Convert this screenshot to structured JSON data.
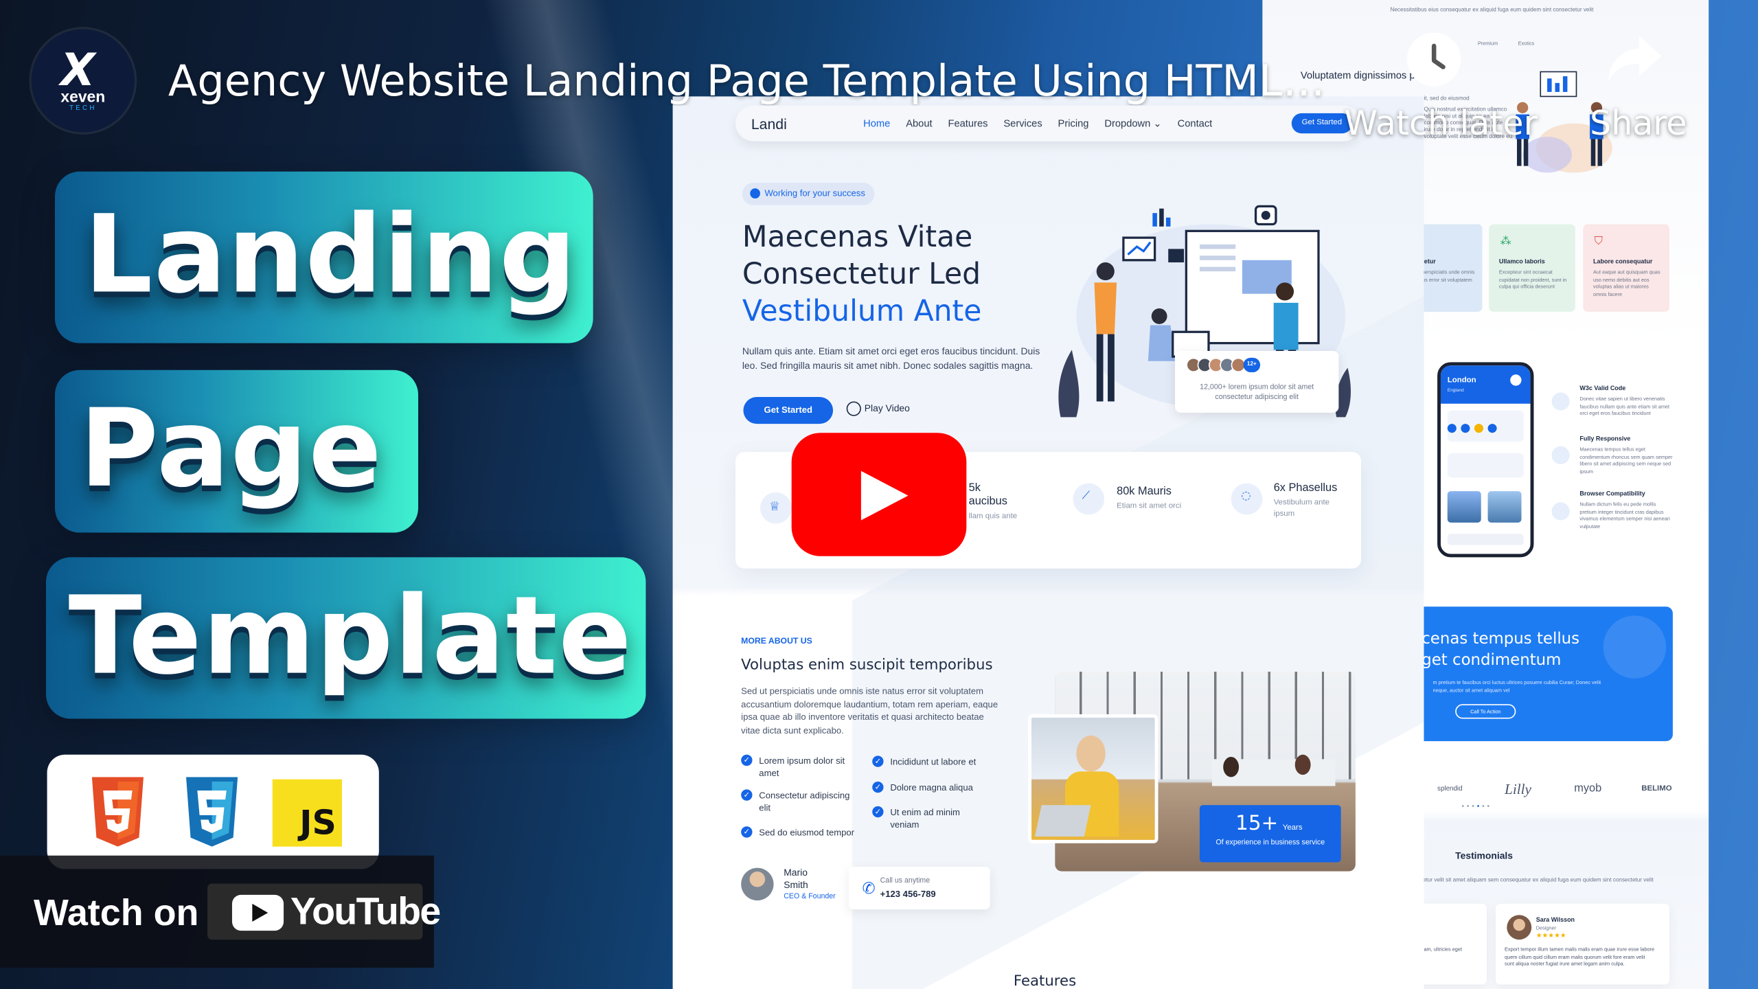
{
  "video": {
    "title": "Agency Website Landing Page Template Using HTML C...",
    "watch_later": "Watch later",
    "share": "Share",
    "watch_on": "Watch on",
    "youtube": "YouTube"
  },
  "channel": {
    "name": "xeven",
    "tag": "TECH"
  },
  "thumbnail": {
    "line1": "Landing",
    "line2": "Page",
    "line3": "Template",
    "badges": [
      "html5-icon",
      "css3-icon",
      "js-icon"
    ],
    "js_label": "JS"
  },
  "mockup": {
    "brand": "Landi",
    "nav": [
      "Home",
      "About",
      "Features",
      "Services",
      "Pricing",
      "Dropdown",
      "Contact"
    ],
    "nav_cta": "Get Started",
    "chip": "Working for your success",
    "heading_l1": "Maecenas Vitae",
    "heading_l2": "Consectetur Led",
    "heading_l3": "Vestibulum Ante",
    "paragraph": "Nullam quis ante. Etiam sit amet orci eget eros faucibus tincidunt. Duis leo. Sed fringilla mauris sit amet nibh. Donec sodales sagittis magna.",
    "btn_primary": "Get Started",
    "btn_play": "Play Video",
    "card_note": "12,000+ lorem ipsum dolor sit amet consectetur adipiscing elit",
    "card_count": "12+",
    "stats": [
      {
        "title": "5k",
        "title2": "aucibus",
        "sub": "llam quis ante"
      },
      {
        "title": "80k Mauris",
        "sub": "Etiam sit amet orci"
      },
      {
        "title": "6x Phasellus",
        "sub": "Vestibulum ante ipsum"
      }
    ],
    "more_label": "MORE ABOUT US",
    "about_title": "Voluptas enim suscipit temporibus",
    "about_text": "Sed ut perspiciatis unde omnis iste natus error sit voluptatem accusantium doloremque laudantium, totam rem aperiam, eaque ipsa quae ab illo inventore veritatis et quasi architecto beatae vitae dicta sunt explicabo.",
    "checks_left": [
      "Lorem ipsum dolor sit amet",
      "Consectetur adipiscing elit",
      "Sed do eiusmod tempor"
    ],
    "checks_right": [
      "Incididunt ut labore et",
      "Dolore magna aliqua",
      "Ut enim ad minim veniam"
    ],
    "author_name": "Mario Smith",
    "author_role": "CEO & Founder",
    "call_label": "Call us anytime",
    "call_number": "+123 456-789",
    "years_num": "15+",
    "years_unit": "Years",
    "years_sub": "Of experience in business service",
    "features_heading": "Features"
  },
  "right_page": {
    "top_text": "Necessitatibus eius consequatur ex aliquid fuga eum quidem sint consectetur velit",
    "tabs": [
      "Premium",
      "Exotics"
    ],
    "heading": "Voluptatem dignissimos provident",
    "heading_suffix": "ent",
    "sub": "it, sed do eiusmod",
    "sub2": "Quis nostrud exercitation ullamco laboris nisi ut aliquip ex ea commodo consequat. Duis aute irure dolor in reprehenderit in voluptate velit esse cillum dolore eu",
    "cards": [
      {
        "title": "abo ctetur",
        "desc": "Sed ut perspiciatis unde omnis iste natus error sit voluptatem",
        "color": "#dbe8f7"
      },
      {
        "title": "Ullamco laboris",
        "desc": "Excepteur sint occaecat cupidatat non proident, sunt in culpa qui officia deserunt",
        "color": "#e3f3ea"
      },
      {
        "title": "Labore consequatur",
        "desc": "Aut eaque aut quisquam quas uso nemo debitis aut eos voluptas alias ut maiores omnis facere",
        "color": "#fbe7e7"
      }
    ],
    "phone_city": "London",
    "phone_country": "England",
    "features": [
      {
        "title": "W3c Valid Code",
        "desc": "Donec vitae sapien ut libero venenatis faucibus nullam quis ante etiam sit amet orci eget eros faucibus tincidunt"
      },
      {
        "title": "Fully Responsive",
        "desc": "Maecenas tempus tellus eget condimentum rhoncus sem quam semper libero sit amet adipiscing sem neque sed ipsum"
      },
      {
        "title": "Browser Compatibility",
        "desc": "Nullam dictum felis eu pede mollis pretium integer tincidunt cras dapibus vivamus elementum semper nisi aenean vulputate"
      }
    ],
    "cta_title_l1": "cenas tempus tellus",
    "cta_title_l2": "get condimentum",
    "cta_desc": "m pretium te faucibus orci luctus ultrices posuere cubilia Curae; Donec velit neque, auctor sit amet aliquam vel",
    "cta_button": "Call To Action",
    "brands": [
      "splendid",
      "Lilly",
      "myob",
      "BELIMO"
    ],
    "testimonials_title": "Testimonials",
    "testimonials_sub": "it consectetur velit sit amet aliquam sem consequatur ex aliquid fuga eum quidem sint consectetur velit",
    "reviewer_name": "Sara Wilsson",
    "reviewer_role": "Designer",
    "stars": "★★★★★",
    "quote": "Export tempor illum tamen malis malis eram quae irure esse labore quem cillum quid cillum eram malis quorum velit fore eram velit sunt aliqua noster fugiat irure amet legam anim culpa.",
    "quote_left": "am, ultricies eget"
  },
  "colors": {
    "accent": "#1565e6",
    "youtube_red": "#ff0000",
    "teal": "#3ff0cf"
  }
}
